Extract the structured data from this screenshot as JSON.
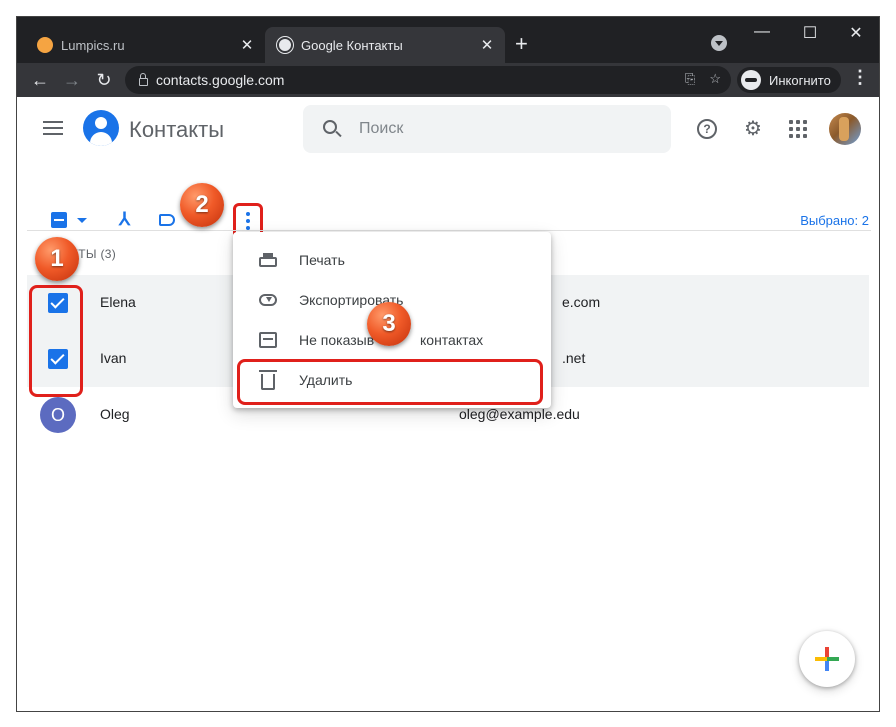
{
  "browser": {
    "tabs": [
      {
        "title": "Lumpics.ru",
        "close": "✕"
      },
      {
        "title": "Google Контакты",
        "close": "✕"
      }
    ],
    "new_tab": "+",
    "window_controls": {
      "minimize": "—",
      "maximize": "☐",
      "close": "✕"
    },
    "nav": {
      "back": "←",
      "forward": "→",
      "reload": "↻"
    },
    "url": "contacts.google.com",
    "translate_icon": "⎘",
    "bookmark_icon": "☆",
    "incognito_label": "Инкогнито",
    "menu": "⋮"
  },
  "app": {
    "title": "Контакты",
    "search_placeholder": "Поиск",
    "help_glyph": "?",
    "settings_glyph": "⚙",
    "merge_glyph": "⅄",
    "selected_count": "Выбрано: 2",
    "section_label": "КТЫ (3)",
    "contacts": [
      {
        "name": "Elena",
        "email": "e.com",
        "selected": true
      },
      {
        "name": "Ivan",
        "email": ".net",
        "selected": true
      },
      {
        "name": "Oleg",
        "email": "oleg@example.edu",
        "avatar_letter": "O",
        "selected": false
      }
    ],
    "menu_items": [
      {
        "label": "Печать",
        "icon": "printer-icon"
      },
      {
        "label": "Экспортировать",
        "icon": "cloud-download-icon"
      },
      {
        "label": "Не показыв",
        "label_tail": "контактах",
        "icon": "archive-icon"
      },
      {
        "label": "Удалить",
        "icon": "trash-icon"
      }
    ]
  },
  "annotations": {
    "step1": "1",
    "step2": "2",
    "step3": "3"
  },
  "colors": {
    "accent": "#1a73e8",
    "callout": "#e0201b",
    "badge": "#f05a28",
    "avatar_oleg": "#5c6bc0"
  }
}
